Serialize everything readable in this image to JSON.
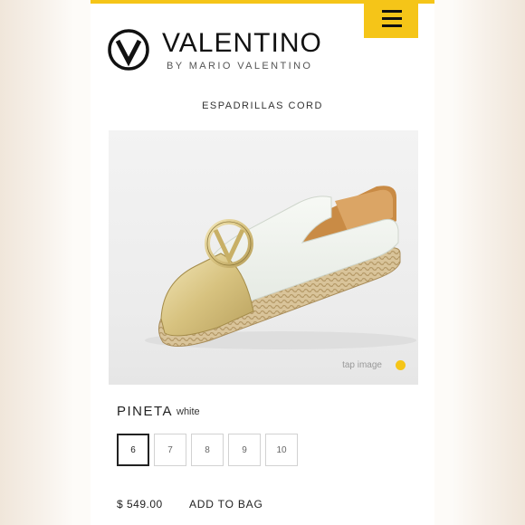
{
  "brand": {
    "name": "VALENTINO",
    "tagline": "BY MARIO VALENTINO",
    "accent_color": "#f5c518"
  },
  "header": {
    "menu_icon": "hamburger-menu-icon"
  },
  "category": "ESPADRILLAS CORD",
  "product": {
    "image_hint": "tap image",
    "name": "PINETA",
    "color": "white",
    "sizes": [
      "6",
      "7",
      "8",
      "9",
      "10"
    ],
    "selected_size": "6",
    "price": "$ 549.00",
    "add_to_bag": "ADD TO BAG"
  }
}
